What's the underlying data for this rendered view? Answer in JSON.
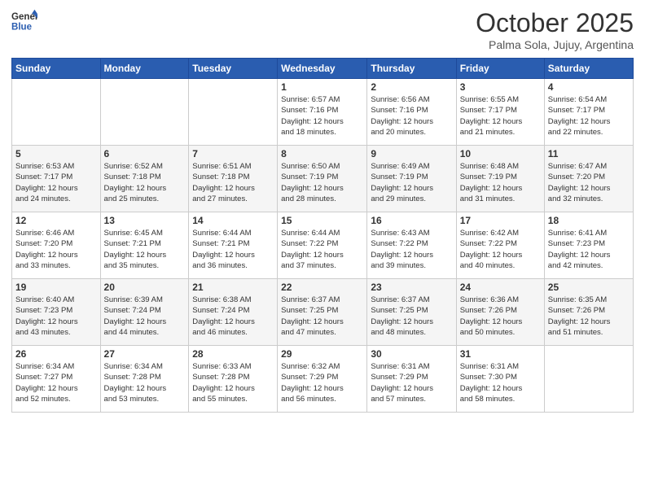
{
  "header": {
    "logo_line1": "General",
    "logo_line2": "Blue",
    "month": "October 2025",
    "location": "Palma Sola, Jujuy, Argentina"
  },
  "weekdays": [
    "Sunday",
    "Monday",
    "Tuesday",
    "Wednesday",
    "Thursday",
    "Friday",
    "Saturday"
  ],
  "weeks": [
    [
      {
        "day": "",
        "info": ""
      },
      {
        "day": "",
        "info": ""
      },
      {
        "day": "",
        "info": ""
      },
      {
        "day": "1",
        "info": "Sunrise: 6:57 AM\nSunset: 7:16 PM\nDaylight: 12 hours\nand 18 minutes."
      },
      {
        "day": "2",
        "info": "Sunrise: 6:56 AM\nSunset: 7:16 PM\nDaylight: 12 hours\nand 20 minutes."
      },
      {
        "day": "3",
        "info": "Sunrise: 6:55 AM\nSunset: 7:17 PM\nDaylight: 12 hours\nand 21 minutes."
      },
      {
        "day": "4",
        "info": "Sunrise: 6:54 AM\nSunset: 7:17 PM\nDaylight: 12 hours\nand 22 minutes."
      }
    ],
    [
      {
        "day": "5",
        "info": "Sunrise: 6:53 AM\nSunset: 7:17 PM\nDaylight: 12 hours\nand 24 minutes."
      },
      {
        "day": "6",
        "info": "Sunrise: 6:52 AM\nSunset: 7:18 PM\nDaylight: 12 hours\nand 25 minutes."
      },
      {
        "day": "7",
        "info": "Sunrise: 6:51 AM\nSunset: 7:18 PM\nDaylight: 12 hours\nand 27 minutes."
      },
      {
        "day": "8",
        "info": "Sunrise: 6:50 AM\nSunset: 7:19 PM\nDaylight: 12 hours\nand 28 minutes."
      },
      {
        "day": "9",
        "info": "Sunrise: 6:49 AM\nSunset: 7:19 PM\nDaylight: 12 hours\nand 29 minutes."
      },
      {
        "day": "10",
        "info": "Sunrise: 6:48 AM\nSunset: 7:19 PM\nDaylight: 12 hours\nand 31 minutes."
      },
      {
        "day": "11",
        "info": "Sunrise: 6:47 AM\nSunset: 7:20 PM\nDaylight: 12 hours\nand 32 minutes."
      }
    ],
    [
      {
        "day": "12",
        "info": "Sunrise: 6:46 AM\nSunset: 7:20 PM\nDaylight: 12 hours\nand 33 minutes."
      },
      {
        "day": "13",
        "info": "Sunrise: 6:45 AM\nSunset: 7:21 PM\nDaylight: 12 hours\nand 35 minutes."
      },
      {
        "day": "14",
        "info": "Sunrise: 6:44 AM\nSunset: 7:21 PM\nDaylight: 12 hours\nand 36 minutes."
      },
      {
        "day": "15",
        "info": "Sunrise: 6:44 AM\nSunset: 7:22 PM\nDaylight: 12 hours\nand 37 minutes."
      },
      {
        "day": "16",
        "info": "Sunrise: 6:43 AM\nSunset: 7:22 PM\nDaylight: 12 hours\nand 39 minutes."
      },
      {
        "day": "17",
        "info": "Sunrise: 6:42 AM\nSunset: 7:22 PM\nDaylight: 12 hours\nand 40 minutes."
      },
      {
        "day": "18",
        "info": "Sunrise: 6:41 AM\nSunset: 7:23 PM\nDaylight: 12 hours\nand 42 minutes."
      }
    ],
    [
      {
        "day": "19",
        "info": "Sunrise: 6:40 AM\nSunset: 7:23 PM\nDaylight: 12 hours\nand 43 minutes."
      },
      {
        "day": "20",
        "info": "Sunrise: 6:39 AM\nSunset: 7:24 PM\nDaylight: 12 hours\nand 44 minutes."
      },
      {
        "day": "21",
        "info": "Sunrise: 6:38 AM\nSunset: 7:24 PM\nDaylight: 12 hours\nand 46 minutes."
      },
      {
        "day": "22",
        "info": "Sunrise: 6:37 AM\nSunset: 7:25 PM\nDaylight: 12 hours\nand 47 minutes."
      },
      {
        "day": "23",
        "info": "Sunrise: 6:37 AM\nSunset: 7:25 PM\nDaylight: 12 hours\nand 48 minutes."
      },
      {
        "day": "24",
        "info": "Sunrise: 6:36 AM\nSunset: 7:26 PM\nDaylight: 12 hours\nand 50 minutes."
      },
      {
        "day": "25",
        "info": "Sunrise: 6:35 AM\nSunset: 7:26 PM\nDaylight: 12 hours\nand 51 minutes."
      }
    ],
    [
      {
        "day": "26",
        "info": "Sunrise: 6:34 AM\nSunset: 7:27 PM\nDaylight: 12 hours\nand 52 minutes."
      },
      {
        "day": "27",
        "info": "Sunrise: 6:34 AM\nSunset: 7:28 PM\nDaylight: 12 hours\nand 53 minutes."
      },
      {
        "day": "28",
        "info": "Sunrise: 6:33 AM\nSunset: 7:28 PM\nDaylight: 12 hours\nand 55 minutes."
      },
      {
        "day": "29",
        "info": "Sunrise: 6:32 AM\nSunset: 7:29 PM\nDaylight: 12 hours\nand 56 minutes."
      },
      {
        "day": "30",
        "info": "Sunrise: 6:31 AM\nSunset: 7:29 PM\nDaylight: 12 hours\nand 57 minutes."
      },
      {
        "day": "31",
        "info": "Sunrise: 6:31 AM\nSunset: 7:30 PM\nDaylight: 12 hours\nand 58 minutes."
      },
      {
        "day": "",
        "info": ""
      }
    ]
  ]
}
